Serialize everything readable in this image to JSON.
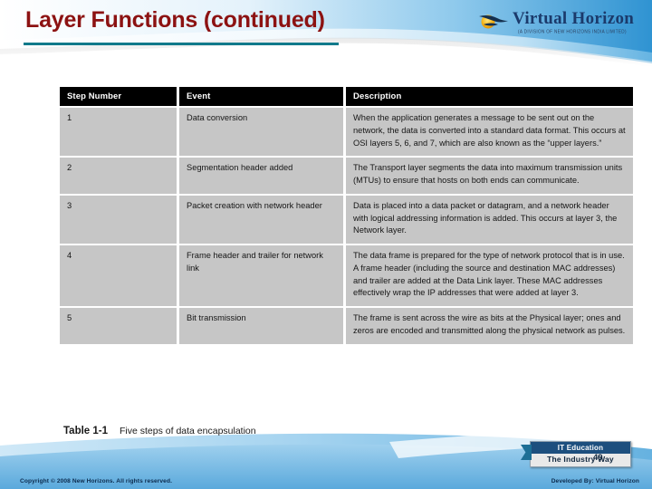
{
  "slide": {
    "title": "Layer Functions (continued)",
    "title_color": "#8c1212",
    "rule_color": "#117a8b"
  },
  "logo": {
    "mark": "sun-bird-icon",
    "name": "Virtual Horizon",
    "tagline": "(A DIVISION OF NEW HORIZONS INDIA LIMITED)"
  },
  "table": {
    "headers": [
      "Step Number",
      "Event",
      "Description"
    ],
    "header_bg": "#000000",
    "cell_bg": "#c6c6c6",
    "rows": [
      {
        "step": "1",
        "event": "Data conversion",
        "description": "When the application generates a message to be sent out on the network, the data is converted into a standard data format. This occurs at OSI layers 5, 6, and 7, which are also known as the “upper layers.”"
      },
      {
        "step": "2",
        "event": "Segmentation header added",
        "description": "The Transport layer segments the data into maximum transmission units (MTUs) to ensure that hosts on both ends can communicate."
      },
      {
        "step": "3",
        "event": "Packet creation with network header",
        "description": "Data is placed into a data packet or datagram, and a network header with logical addressing information is added. This occurs at layer 3, the Network layer."
      },
      {
        "step": "4",
        "event": "Frame header and trailer for network link",
        "description": "The data frame is prepared for the type of network protocol that is in use. A frame header (including the source and destination MAC addresses) and trailer are added at the Data Link layer. These MAC addresses effectively wrap the IP addresses that were added at layer 3."
      },
      {
        "step": "5",
        "event": "Bit transmission",
        "description": "The frame is sent across the wire as bits at the Physical layer; ones and zeros are encoded and transmitted along the physical network as pulses."
      }
    ]
  },
  "caption": {
    "label": "Table 1-1",
    "text": "Five steps of data encapsulation"
  },
  "badge": {
    "top_line": "IT Education",
    "bottom_line": "The Industry Way"
  },
  "footer": {
    "left": "Copyright © 2008 New Horizons. All rights reserved.",
    "right": "Developed By: Virtual Horizon",
    "page_number": "49"
  }
}
